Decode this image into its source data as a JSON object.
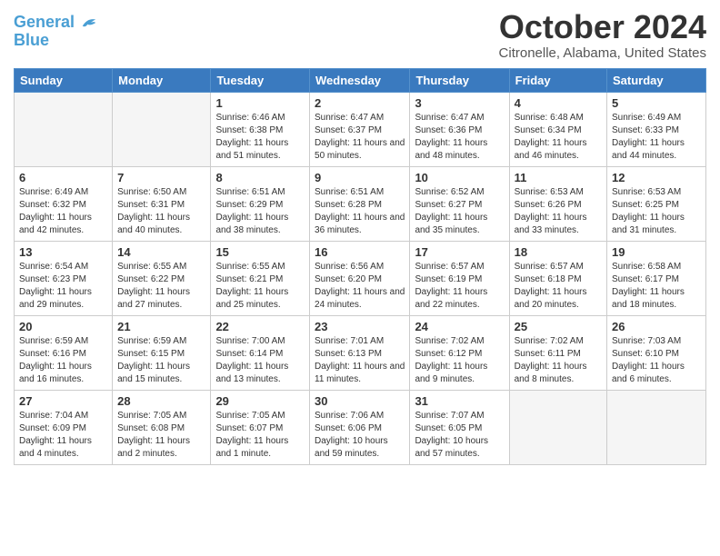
{
  "logo": {
    "line1": "General",
    "line2": "Blue"
  },
  "title": "October 2024",
  "location": "Citronelle, Alabama, United States",
  "weekdays": [
    "Sunday",
    "Monday",
    "Tuesday",
    "Wednesday",
    "Thursday",
    "Friday",
    "Saturday"
  ],
  "weeks": [
    [
      {
        "day": "",
        "sunrise": "",
        "sunset": "",
        "daylight": "",
        "empty": true
      },
      {
        "day": "",
        "sunrise": "",
        "sunset": "",
        "daylight": "",
        "empty": true
      },
      {
        "day": "1",
        "sunrise": "Sunrise: 6:46 AM",
        "sunset": "Sunset: 6:38 PM",
        "daylight": "Daylight: 11 hours and 51 minutes."
      },
      {
        "day": "2",
        "sunrise": "Sunrise: 6:47 AM",
        "sunset": "Sunset: 6:37 PM",
        "daylight": "Daylight: 11 hours and 50 minutes."
      },
      {
        "day": "3",
        "sunrise": "Sunrise: 6:47 AM",
        "sunset": "Sunset: 6:36 PM",
        "daylight": "Daylight: 11 hours and 48 minutes."
      },
      {
        "day": "4",
        "sunrise": "Sunrise: 6:48 AM",
        "sunset": "Sunset: 6:34 PM",
        "daylight": "Daylight: 11 hours and 46 minutes."
      },
      {
        "day": "5",
        "sunrise": "Sunrise: 6:49 AM",
        "sunset": "Sunset: 6:33 PM",
        "daylight": "Daylight: 11 hours and 44 minutes."
      }
    ],
    [
      {
        "day": "6",
        "sunrise": "Sunrise: 6:49 AM",
        "sunset": "Sunset: 6:32 PM",
        "daylight": "Daylight: 11 hours and 42 minutes."
      },
      {
        "day": "7",
        "sunrise": "Sunrise: 6:50 AM",
        "sunset": "Sunset: 6:31 PM",
        "daylight": "Daylight: 11 hours and 40 minutes."
      },
      {
        "day": "8",
        "sunrise": "Sunrise: 6:51 AM",
        "sunset": "Sunset: 6:29 PM",
        "daylight": "Daylight: 11 hours and 38 minutes."
      },
      {
        "day": "9",
        "sunrise": "Sunrise: 6:51 AM",
        "sunset": "Sunset: 6:28 PM",
        "daylight": "Daylight: 11 hours and 36 minutes."
      },
      {
        "day": "10",
        "sunrise": "Sunrise: 6:52 AM",
        "sunset": "Sunset: 6:27 PM",
        "daylight": "Daylight: 11 hours and 35 minutes."
      },
      {
        "day": "11",
        "sunrise": "Sunrise: 6:53 AM",
        "sunset": "Sunset: 6:26 PM",
        "daylight": "Daylight: 11 hours and 33 minutes."
      },
      {
        "day": "12",
        "sunrise": "Sunrise: 6:53 AM",
        "sunset": "Sunset: 6:25 PM",
        "daylight": "Daylight: 11 hours and 31 minutes."
      }
    ],
    [
      {
        "day": "13",
        "sunrise": "Sunrise: 6:54 AM",
        "sunset": "Sunset: 6:23 PM",
        "daylight": "Daylight: 11 hours and 29 minutes."
      },
      {
        "day": "14",
        "sunrise": "Sunrise: 6:55 AM",
        "sunset": "Sunset: 6:22 PM",
        "daylight": "Daylight: 11 hours and 27 minutes."
      },
      {
        "day": "15",
        "sunrise": "Sunrise: 6:55 AM",
        "sunset": "Sunset: 6:21 PM",
        "daylight": "Daylight: 11 hours and 25 minutes."
      },
      {
        "day": "16",
        "sunrise": "Sunrise: 6:56 AM",
        "sunset": "Sunset: 6:20 PM",
        "daylight": "Daylight: 11 hours and 24 minutes."
      },
      {
        "day": "17",
        "sunrise": "Sunrise: 6:57 AM",
        "sunset": "Sunset: 6:19 PM",
        "daylight": "Daylight: 11 hours and 22 minutes."
      },
      {
        "day": "18",
        "sunrise": "Sunrise: 6:57 AM",
        "sunset": "Sunset: 6:18 PM",
        "daylight": "Daylight: 11 hours and 20 minutes."
      },
      {
        "day": "19",
        "sunrise": "Sunrise: 6:58 AM",
        "sunset": "Sunset: 6:17 PM",
        "daylight": "Daylight: 11 hours and 18 minutes."
      }
    ],
    [
      {
        "day": "20",
        "sunrise": "Sunrise: 6:59 AM",
        "sunset": "Sunset: 6:16 PM",
        "daylight": "Daylight: 11 hours and 16 minutes."
      },
      {
        "day": "21",
        "sunrise": "Sunrise: 6:59 AM",
        "sunset": "Sunset: 6:15 PM",
        "daylight": "Daylight: 11 hours and 15 minutes."
      },
      {
        "day": "22",
        "sunrise": "Sunrise: 7:00 AM",
        "sunset": "Sunset: 6:14 PM",
        "daylight": "Daylight: 11 hours and 13 minutes."
      },
      {
        "day": "23",
        "sunrise": "Sunrise: 7:01 AM",
        "sunset": "Sunset: 6:13 PM",
        "daylight": "Daylight: 11 hours and 11 minutes."
      },
      {
        "day": "24",
        "sunrise": "Sunrise: 7:02 AM",
        "sunset": "Sunset: 6:12 PM",
        "daylight": "Daylight: 11 hours and 9 minutes."
      },
      {
        "day": "25",
        "sunrise": "Sunrise: 7:02 AM",
        "sunset": "Sunset: 6:11 PM",
        "daylight": "Daylight: 11 hours and 8 minutes."
      },
      {
        "day": "26",
        "sunrise": "Sunrise: 7:03 AM",
        "sunset": "Sunset: 6:10 PM",
        "daylight": "Daylight: 11 hours and 6 minutes."
      }
    ],
    [
      {
        "day": "27",
        "sunrise": "Sunrise: 7:04 AM",
        "sunset": "Sunset: 6:09 PM",
        "daylight": "Daylight: 11 hours and 4 minutes."
      },
      {
        "day": "28",
        "sunrise": "Sunrise: 7:05 AM",
        "sunset": "Sunset: 6:08 PM",
        "daylight": "Daylight: 11 hours and 2 minutes."
      },
      {
        "day": "29",
        "sunrise": "Sunrise: 7:05 AM",
        "sunset": "Sunset: 6:07 PM",
        "daylight": "Daylight: 11 hours and 1 minute."
      },
      {
        "day": "30",
        "sunrise": "Sunrise: 7:06 AM",
        "sunset": "Sunset: 6:06 PM",
        "daylight": "Daylight: 10 hours and 59 minutes."
      },
      {
        "day": "31",
        "sunrise": "Sunrise: 7:07 AM",
        "sunset": "Sunset: 6:05 PM",
        "daylight": "Daylight: 10 hours and 57 minutes."
      },
      {
        "day": "",
        "sunrise": "",
        "sunset": "",
        "daylight": "",
        "empty": true
      },
      {
        "day": "",
        "sunrise": "",
        "sunset": "",
        "daylight": "",
        "empty": true
      }
    ]
  ]
}
